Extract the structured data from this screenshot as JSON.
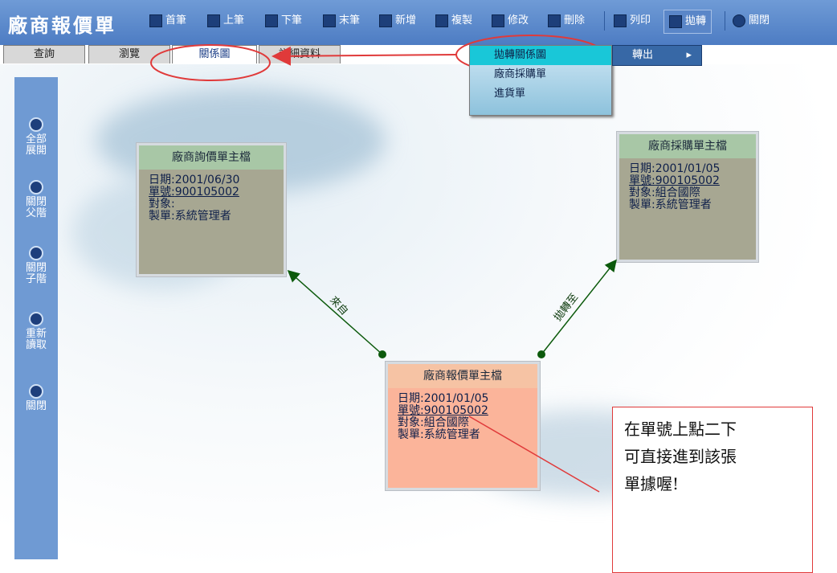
{
  "app": {
    "title": "廠商報價單"
  },
  "toolbar": {
    "first": "首筆",
    "prev": "上筆",
    "next": "下筆",
    "last": "末筆",
    "new": "新增",
    "copy": "複製",
    "edit": "修改",
    "delete": "刪除",
    "print": "列印",
    "transfer": "拋轉",
    "close": "關閉"
  },
  "tabs": {
    "query": "查詢",
    "browse": "瀏覽",
    "relation": "關係圖",
    "detail": "詳細資料"
  },
  "transfer_menu": {
    "items": [
      "拋轉關係圖",
      "廠商採購單",
      "進貨單"
    ],
    "submenu_label": "轉出",
    "submenu_arrow": "▸"
  },
  "sidebar": {
    "items": [
      "全部展開",
      "關閉父階",
      "關閉子階",
      "重新讀取",
      "關閉"
    ]
  },
  "nodes": {
    "source": {
      "title": "廠商詢價單主檔",
      "date": "日期:2001/06/30",
      "no_label": "單號:",
      "no": "900105002",
      "party": "對象:",
      "maker": "製單:系統管理者"
    },
    "target": {
      "title": "廠商採購單主檔",
      "date": "日期:2001/01/05",
      "no_label": "單號:",
      "no": "900105002",
      "party": "對象:組合國際",
      "maker": "製單:系統管理者"
    },
    "current": {
      "title": "廠商報價單主檔",
      "date": "日期:2001/01/05",
      "no_label": "單號:",
      "no": "900105002",
      "party": "對象:組合國際",
      "maker": "製單:系統管理者"
    }
  },
  "edges": {
    "from_label": "來自",
    "to_label": "拋轉至"
  },
  "annotation": {
    "line1": "在單號上點二下",
    "line2": "可直接進到該張",
    "line3": "單據喔!"
  },
  "colors": {
    "toolbar": "#4d7cc3",
    "highlight_ring": "#e03a3a",
    "node_current": "#fbb49a",
    "node_other": "#a7a792"
  }
}
